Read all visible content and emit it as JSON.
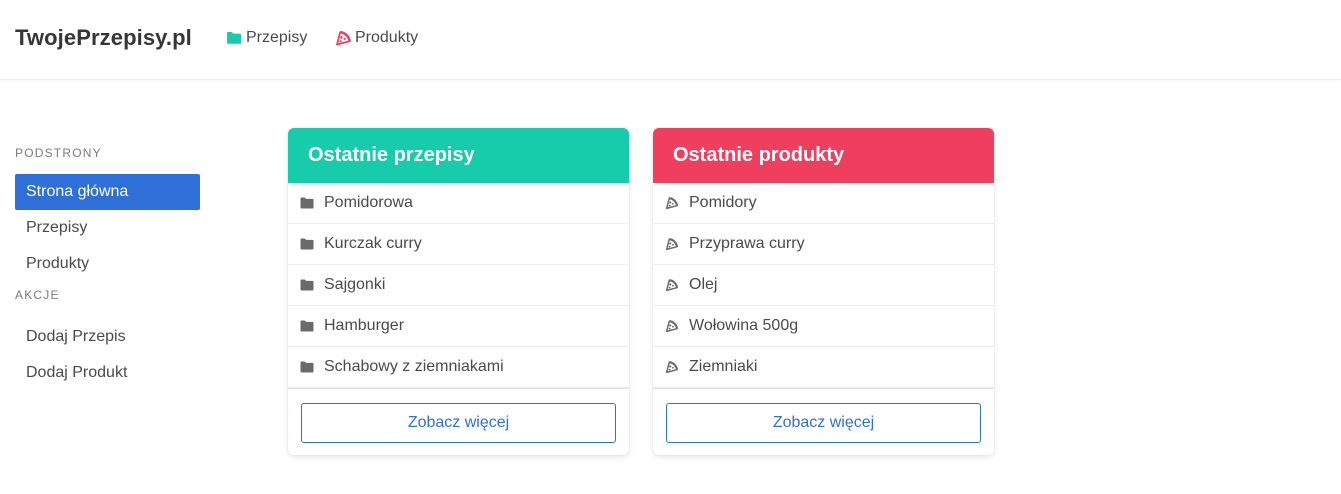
{
  "navbar": {
    "brand": "TwojePrzepisy.pl",
    "items": [
      {
        "label": "Przepisy",
        "icon": "folder-icon",
        "color": "#17ccaa"
      },
      {
        "label": "Produkty",
        "icon": "pizza-slice-icon",
        "color": "#f03e5f"
      }
    ]
  },
  "sidebar": {
    "sections": [
      {
        "label": "PODSTRONY",
        "items": [
          {
            "label": "Strona główna",
            "active": true
          },
          {
            "label": "Przepisy",
            "active": false
          },
          {
            "label": "Produkty",
            "active": false
          }
        ]
      },
      {
        "label": "AKCJE",
        "items": [
          {
            "label": "Dodaj Przepis",
            "active": false
          },
          {
            "label": "Dodaj Produkt",
            "active": false
          }
        ]
      }
    ]
  },
  "recent_recipes": {
    "title": "Ostatnie przepisy",
    "header_color": "#17ccaa",
    "icon": "folder-icon",
    "items": [
      "Pomidorowa",
      "Kurczak curry",
      "Sajgonki",
      "Hamburger",
      "Schabowy z ziemniakami"
    ],
    "more_button": "Zobacz więcej"
  },
  "recent_products": {
    "title": "Ostatnie produkty",
    "header_color": "#f03e5f",
    "icon": "pizza-slice-icon",
    "items": [
      "Pomidory",
      "Przyprawa curry",
      "Olej",
      "Wołowina 500g",
      "Ziemniaki"
    ],
    "more_button": "Zobacz więcej"
  },
  "colors": {
    "accent_blue": "#2f6fd8",
    "list_icon": "#6a6a6a"
  }
}
